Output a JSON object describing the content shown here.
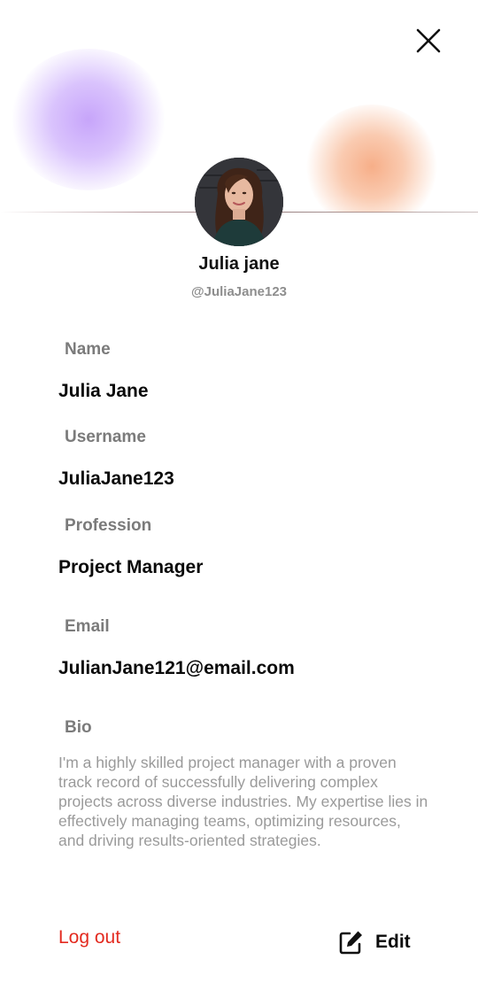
{
  "header": {
    "close_icon": "close-icon"
  },
  "profile": {
    "display_name": "Julia jane",
    "handle": "@JuliaJane123"
  },
  "fields": {
    "name": {
      "label": "Name",
      "value": "Julia Jane"
    },
    "username": {
      "label": "Username",
      "value": "JuliaJane123"
    },
    "profession": {
      "label": "Profession",
      "value": "Project Manager"
    },
    "email": {
      "label": "Email",
      "value": "JulianJane121@email.com"
    },
    "bio": {
      "label": "Bio",
      "value": "I'm a highly skilled project manager with a proven track record of successfully delivering complex projects across diverse industries. My expertise lies in effectively managing teams, optimizing resources, and driving results-oriented strategies."
    }
  },
  "actions": {
    "logout_label": "Log out",
    "edit_label": "Edit",
    "edit_icon": "edit-icon"
  },
  "colors": {
    "logout": "#e32a1f",
    "label": "#7b7b7b",
    "bio_text": "#9a9a9a",
    "blob_purple": "#c9a6fb",
    "blob_orange": "#f6b08c"
  }
}
